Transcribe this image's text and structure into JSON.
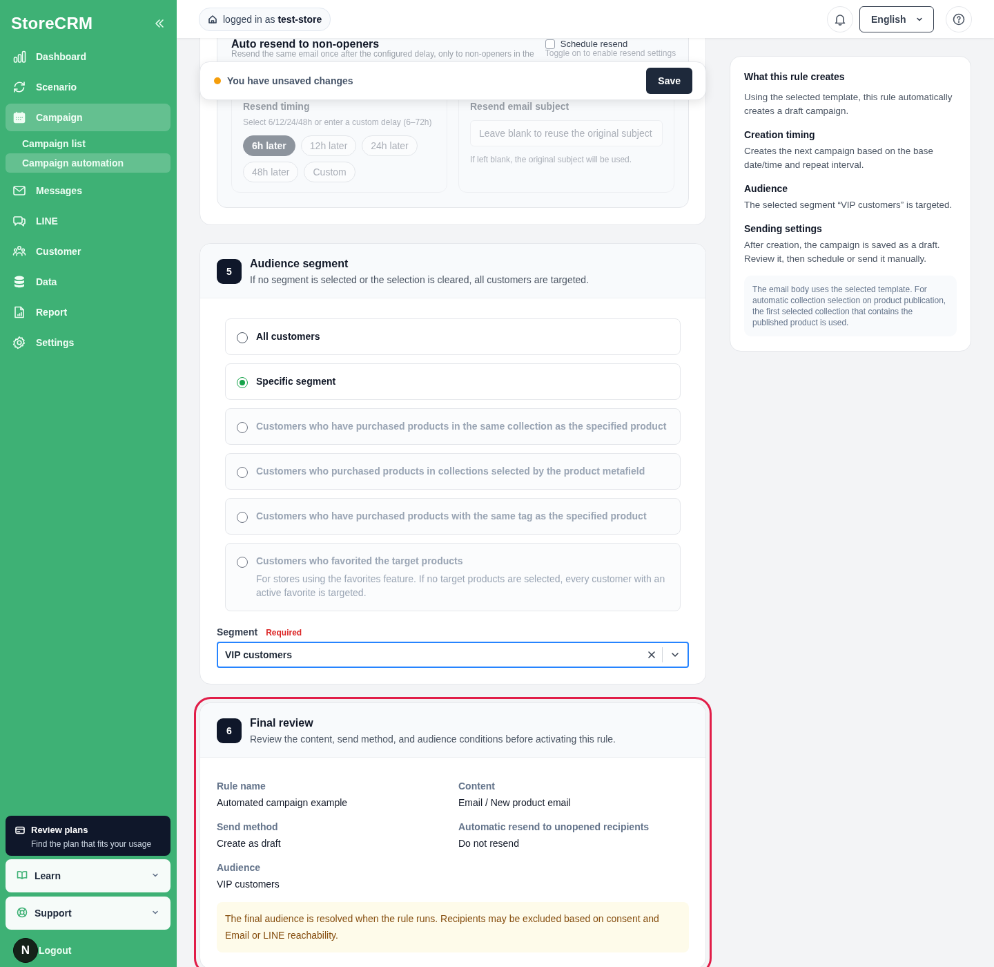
{
  "sidebar": {
    "logo": "StoreCRM",
    "nav": [
      {
        "label": "Dashboard",
        "selected": false
      },
      {
        "label": "Scenario",
        "selected": false
      },
      {
        "label": "Campaign",
        "selected": true,
        "expanded": true,
        "children": [
          {
            "label": "Campaign list",
            "selected": false
          },
          {
            "label": "Campaign automation",
            "selected": true
          }
        ]
      },
      {
        "label": "Messages",
        "selected": false
      },
      {
        "label": "LINE",
        "selected": false
      },
      {
        "label": "Customer",
        "selected": false
      },
      {
        "label": "Data",
        "selected": false
      },
      {
        "label": "Report",
        "selected": false
      },
      {
        "label": "Settings",
        "selected": false
      }
    ],
    "plans": {
      "title": "Review plans",
      "subtitle": "Find the plan that fits your usage"
    },
    "menus": [
      {
        "label": "Learn",
        "expanded": false
      },
      {
        "label": "Support",
        "expanded": false
      }
    ],
    "logout": "Logout",
    "avatar": "N"
  },
  "header": {
    "login": "logged in as **test-store**",
    "language": "English"
  },
  "unsaved_bar": {
    "message": "You have unsaved changes",
    "button": "Save"
  },
  "resend": {
    "title": "Auto resend to non-openers",
    "description": "Resend the same email once after the configured delay, only to non-openers in the",
    "toggle": {
      "label": "Schedule resend",
      "checked": false
    },
    "toggle_hint": "Toggle on to enable resend settings",
    "disabled": true,
    "timing": {
      "label": "Resend timing",
      "hint": "Select 6/12/24/48h or enter a custom delay (6–72h)",
      "options": [
        {
          "label": "6h later",
          "selected": true
        },
        {
          "label": "12h later",
          "selected": false
        },
        {
          "label": "24h later",
          "selected": false
        },
        {
          "label": "48h later",
          "selected": false
        },
        {
          "label": "Custom",
          "selected": false
        }
      ]
    },
    "subject": {
      "label": "Resend email subject",
      "placeholder": "Leave blank to reuse the original subject",
      "help": "If left blank, the original subject will be used."
    }
  },
  "audience": {
    "number": "5",
    "title": "Audience segment",
    "description": "If no segment is selected or the selection is cleared, all customers are targeted.",
    "options": [
      {
        "label": "All customers",
        "selected": false,
        "disabled": false
      },
      {
        "label": "Specific segment",
        "selected": true,
        "disabled": false
      },
      {
        "label": "Customers who have purchased products in the same collection as the specified product",
        "selected": false,
        "disabled": true
      },
      {
        "label": "Customers who purchased products in collections selected by the product metafield",
        "selected": false,
        "disabled": true
      },
      {
        "label": "Customers who have purchased products with the same tag as the specified product",
        "selected": false,
        "disabled": true
      },
      {
        "label": "Customers who favorited the target products",
        "description": "For stores using the favorites feature. If no target products are selected, every customer with an active favorite is targeted.",
        "selected": false,
        "disabled": true
      }
    ],
    "segment": {
      "label": "Segment",
      "required": "Required",
      "value": "VIP customers"
    }
  },
  "review": {
    "number": "6",
    "title": "Final review",
    "description": "Review the content, send method, and audience conditions before activating this rule.",
    "highlighted": true,
    "items": [
      {
        "label": "Rule name",
        "value": "Automated campaign example"
      },
      {
        "label": "Content",
        "value": "Email / New product email"
      },
      {
        "label": "Send method",
        "value": "Create as draft"
      },
      {
        "label": "Automatic resend to unopened recipients",
        "value": "Do not resend"
      },
      {
        "label": "Audience",
        "value": "VIP customers"
      }
    ],
    "note": "The final audience is resolved when the rule runs. Recipients may be excluded based on consent and Email or LINE reachability."
  },
  "info": {
    "sections": [
      {
        "heading": "What this rule creates",
        "text": "Using the selected template, this rule automatically creates a draft campaign."
      },
      {
        "heading": "Creation timing",
        "text": "Creates the next campaign based on the base date/time and repeat interval."
      },
      {
        "heading": "Audience",
        "text": "The selected segment “VIP customers” is targeted."
      },
      {
        "heading": "Sending settings",
        "text": "After creation, the campaign is saved as a draft. Review it, then schedule or send it manually."
      }
    ],
    "note": "The email body uses the selected template. For automatic collection selection on product publication, the first selected collection that contains the published product is used."
  }
}
